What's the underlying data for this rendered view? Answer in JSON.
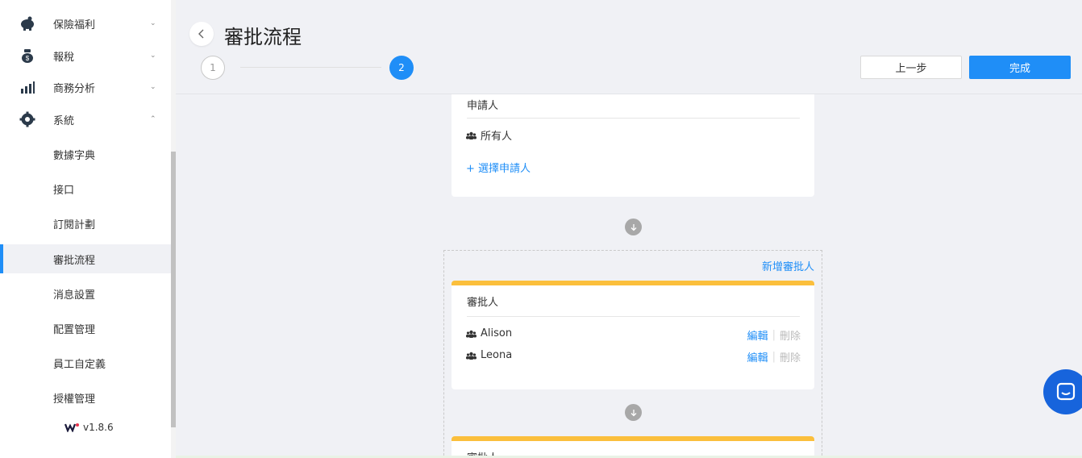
{
  "sidebar": {
    "groups": [
      {
        "label": "保險福利",
        "icon": "piggy-bank-icon",
        "chevron": "down"
      },
      {
        "label": "報稅",
        "icon": "money-bag-icon",
        "chevron": "down"
      },
      {
        "label": "商務分析",
        "icon": "bar-chart-icon",
        "chevron": "down"
      },
      {
        "label": "系統",
        "icon": "gear-icon",
        "chevron": "up"
      }
    ],
    "sub_items": [
      {
        "label": "數據字典"
      },
      {
        "label": "接口"
      },
      {
        "label": "訂閱計劃"
      },
      {
        "label": "審批流程",
        "active": true
      },
      {
        "label": "消息設置"
      },
      {
        "label": "配置管理"
      },
      {
        "label": "員工自定義"
      },
      {
        "label": "授權管理"
      }
    ],
    "version": "v1.8.6"
  },
  "header": {
    "title": "審批流程",
    "steps": [
      "1",
      "2"
    ],
    "current_step": 2,
    "prev_label": "上一步",
    "done_label": "完成"
  },
  "applicant_card": {
    "title": "申請人",
    "people": [
      "所有人"
    ],
    "add_link": "+ 選擇申請人"
  },
  "approver_section": {
    "add_label": "新增審批人",
    "cards": [
      {
        "title": "審批人",
        "people": [
          {
            "name": "Alison",
            "edit": "編輯",
            "delete": "刪除"
          },
          {
            "name": "Leona",
            "edit": "編輯",
            "delete": "刪除"
          }
        ]
      },
      {
        "title": "審批人"
      }
    ]
  },
  "colors": {
    "accent": "#1f8ef7",
    "approver_bar": "#fbbf3c",
    "chat": "#1764dc"
  }
}
